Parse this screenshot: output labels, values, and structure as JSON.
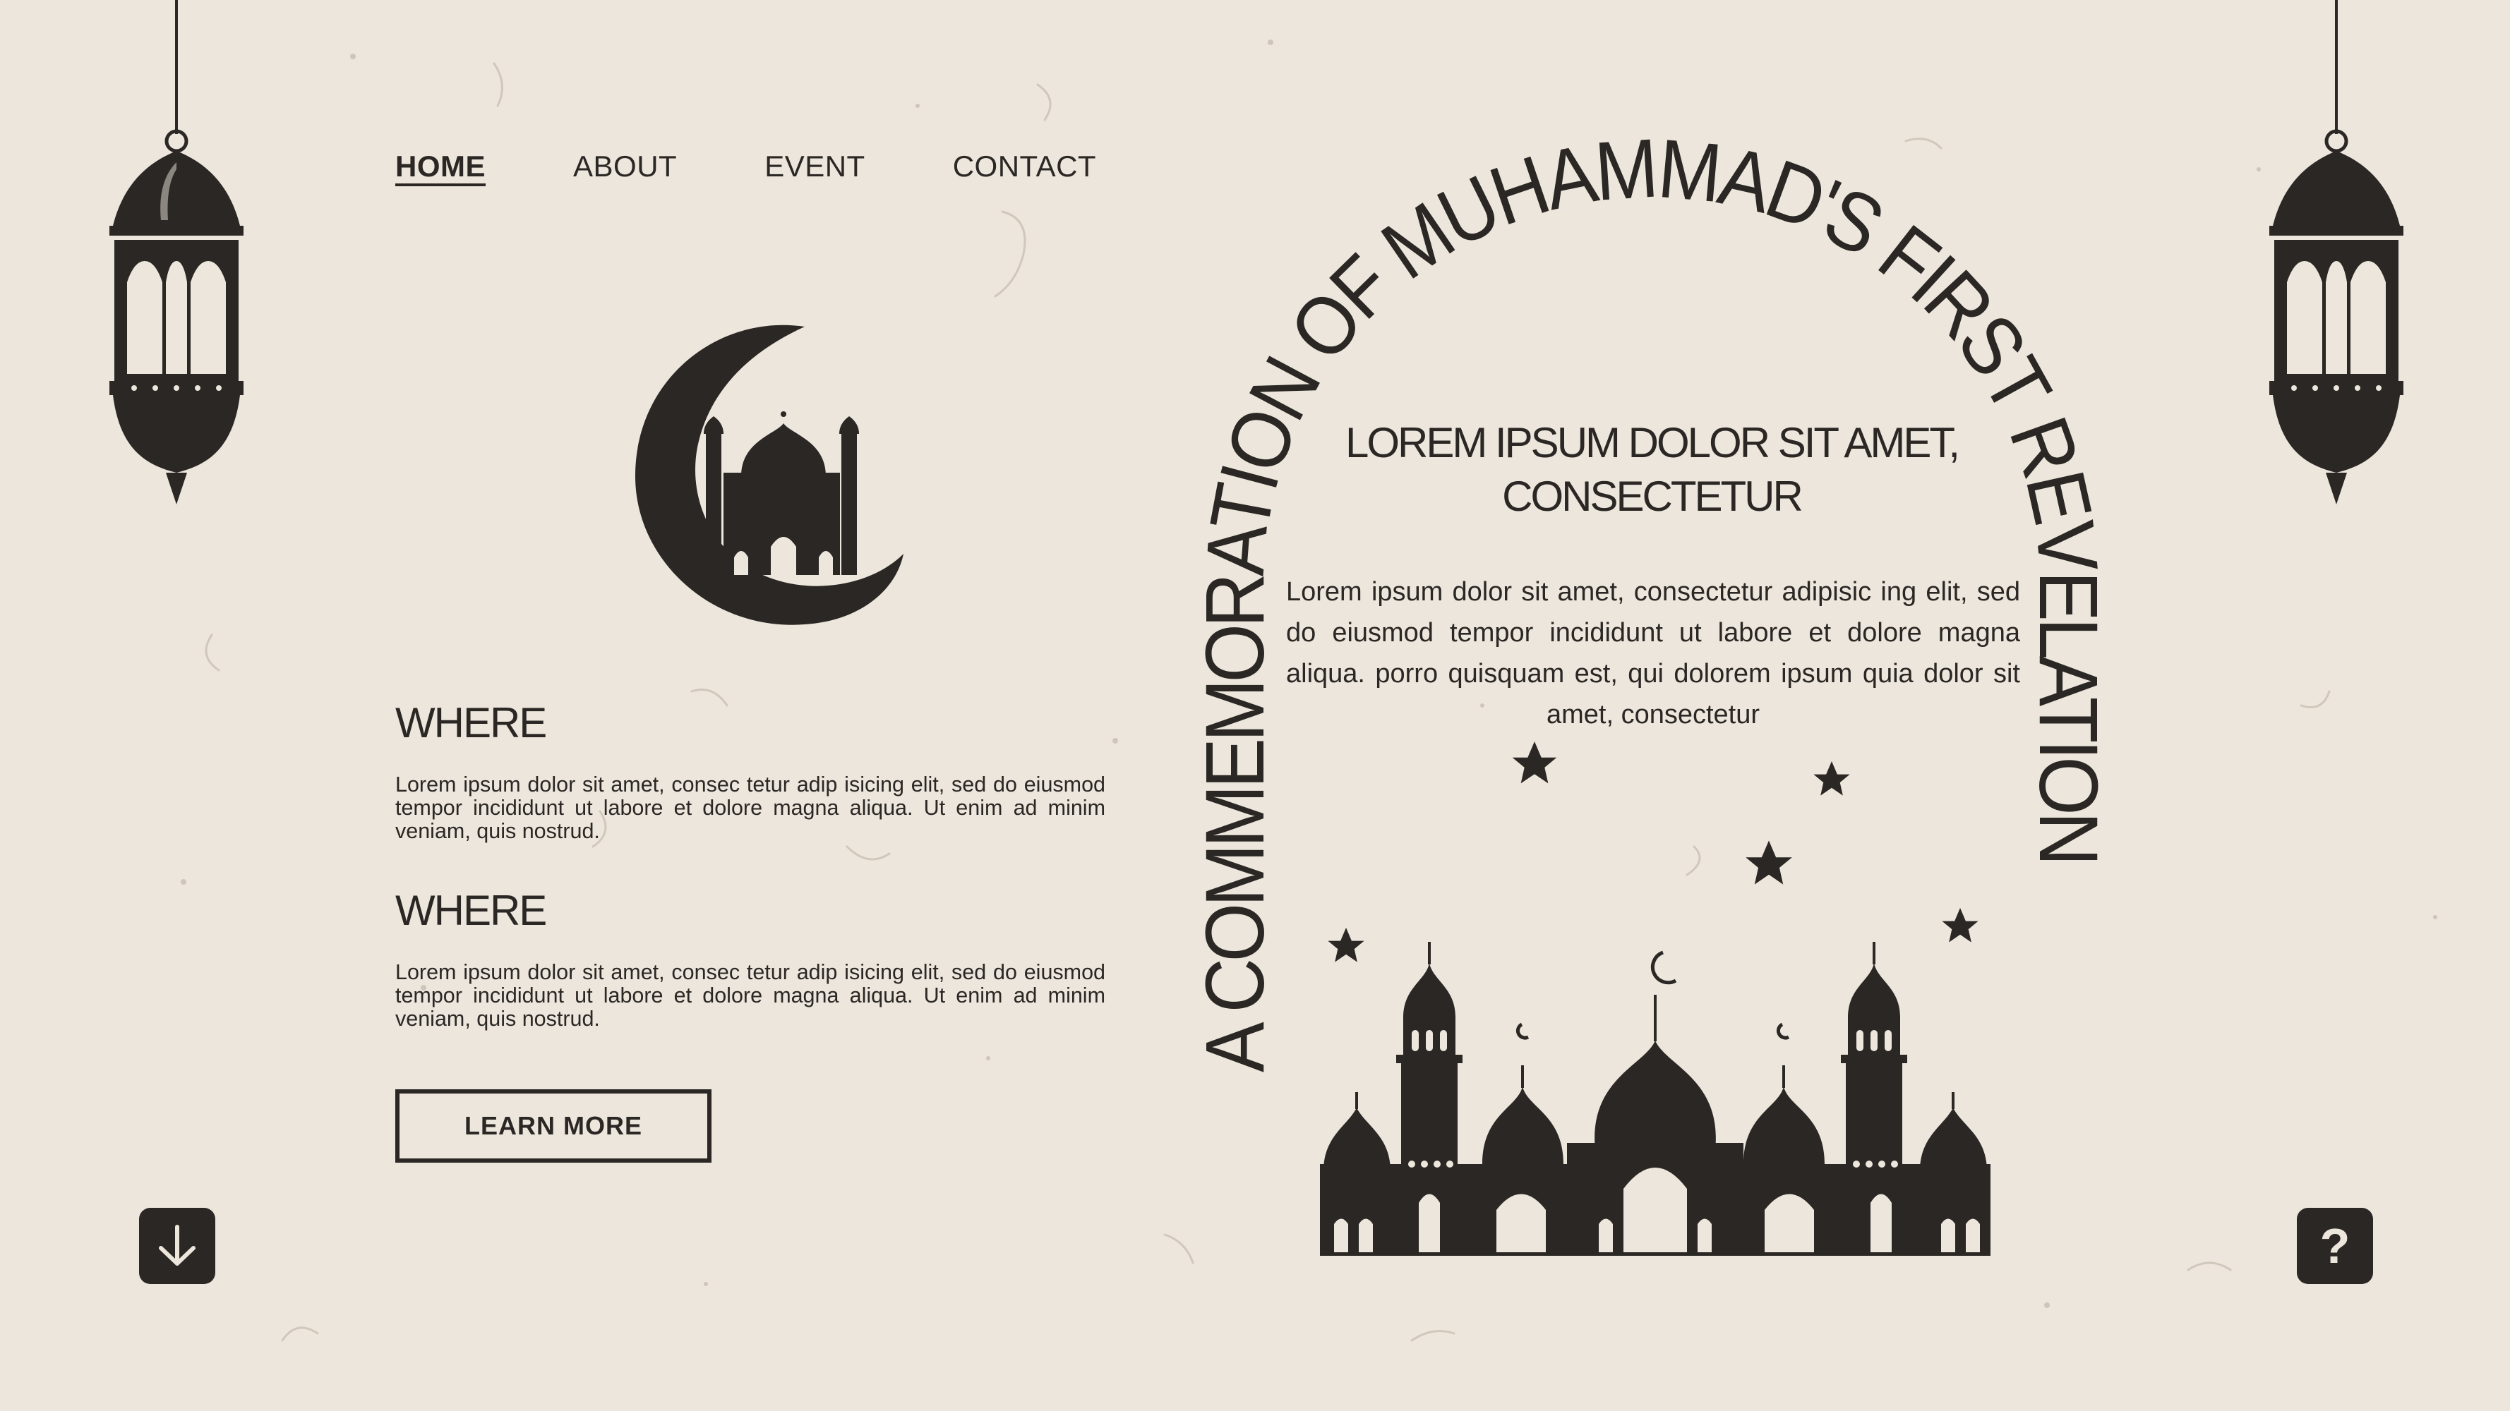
{
  "nav": {
    "items": [
      {
        "label": "HOME",
        "active": true
      },
      {
        "label": "ABOUT",
        "active": false
      },
      {
        "label": "EVENT",
        "active": false
      },
      {
        "label": "CONTACT",
        "active": false
      }
    ]
  },
  "sections": [
    {
      "heading": "WHERE",
      "text": "Lorem ipsum dolor sit amet, consec tetur adip isicing elit, sed do eiusmod tempor incididunt ut labore et dolore magna aliqua. Ut enim ad minim veniam, quis nostrud."
    },
    {
      "heading": "WHERE",
      "text": "Lorem ipsum dolor sit amet, consec tetur adip isicing elit, sed do eiusmod tempor incididunt ut labore et dolore magna aliqua. Ut enim ad minim veniam, quis nostrud."
    }
  ],
  "learn_more_label": "LEARN MORE",
  "arch_title": "A COMMEMORATION OF MUHAMMAD'S FIRST REVELATION",
  "center": {
    "title_line1": "LOREM IPSUM DOLOR SIT AMET,",
    "title_line2": "CONSECTETUR",
    "text": "Lorem ipsum dolor sit amet, consectetur adipisic ing elit, sed do eiusmod tempor incididunt ut labore et dolore magna aliqua. porro quisquam est, qui dolorem ipsum quia dolor sit amet, consectetur"
  },
  "icons": {
    "scroll_down": "arrow-down-icon",
    "help": "question-icon",
    "help_glyph": "?"
  },
  "colors": {
    "background": "#ede6dc",
    "ink": "#2a2724"
  }
}
